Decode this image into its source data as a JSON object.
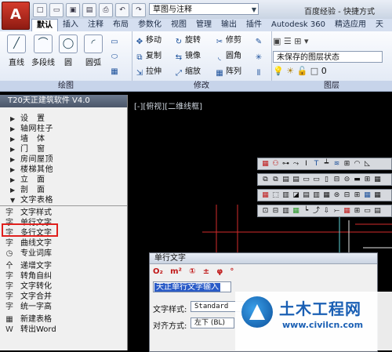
{
  "app_button": "A",
  "title_bar": {
    "workspace": "草图与注释",
    "title": "百度经验 - 快捷方式"
  },
  "tabs": [
    "默认",
    "插入",
    "注释",
    "布局",
    "参数化",
    "视图",
    "管理",
    "输出",
    "插件",
    "Autodesk 360",
    "精选应用",
    "天"
  ],
  "ribbon": {
    "draw": {
      "title": "绘图",
      "tools": [
        "直线",
        "多段线",
        "圆",
        "圆弧"
      ]
    },
    "modify": {
      "title": "修改",
      "tools": [
        "移动",
        "旋转",
        "修剪",
        "复制",
        "镜像",
        "圆角",
        "拉伸",
        "缩放",
        "阵列"
      ]
    },
    "layers": {
      "title": "图层",
      "state": "未保存的图层状态",
      "current": "0"
    }
  },
  "palette": {
    "title": "T20天正建筑软件 V4.0",
    "menu": [
      "设　置",
      "轴网柱子",
      "墙　体",
      "门　窗",
      "房间屋顶",
      "楼梯其他",
      "立　面",
      "剖　面",
      "文字表格"
    ],
    "commands": [
      "文字样式",
      "单行文字",
      "多行文字",
      "曲线文字",
      "专业词库",
      "递增文字",
      "转角自纠",
      "文字转化",
      "文字合并",
      "统一字高",
      "新建表格",
      "转出Word"
    ]
  },
  "canvas": {
    "view_label": "[-][俯视][二维线框]"
  },
  "dialog": {
    "title": "单行文字",
    "tools": [
      "O₂",
      "m²",
      "①",
      "±",
      "φ",
      "°"
    ],
    "input_text": "天正单行文字输入",
    "style_label": "文字样式:",
    "style_value": "Standard",
    "align_label": "对齐方式:",
    "align_value": "左下 (BL)"
  },
  "watermark": {
    "title": "土木工程网",
    "url": "www.civilcn.com"
  }
}
